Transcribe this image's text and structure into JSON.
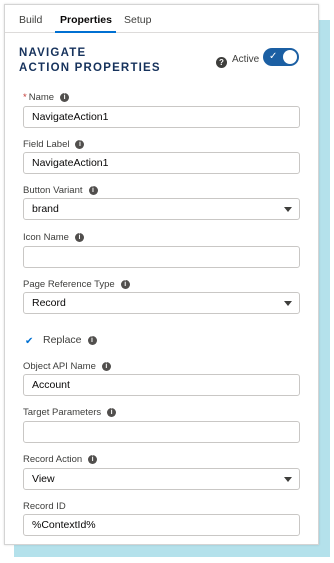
{
  "tabs": [
    {
      "label": "Build"
    },
    {
      "label": "Properties"
    },
    {
      "label": "Setup"
    }
  ],
  "header": {
    "title": "NAVIGATE\nACTION PROPERTIES",
    "active_label": "Active",
    "toggle_check": "✓"
  },
  "fields": {
    "name": {
      "label": "Name",
      "value": "NavigateAction1",
      "required_mark": "*"
    },
    "field_label": {
      "label": "Field Label",
      "value": "NavigateAction1"
    },
    "button_variant": {
      "label": "Button Variant",
      "value": "brand"
    },
    "icon_name": {
      "label": "Icon Name",
      "value": ""
    },
    "page_reference_type": {
      "label": "Page Reference Type",
      "value": "Record"
    },
    "replace": {
      "label": "Replace",
      "check": "✔"
    },
    "object_api_name": {
      "label": "Object API Name",
      "value": "Account"
    },
    "target_parameters": {
      "label": "Target Parameters",
      "value": ""
    },
    "record_action": {
      "label": "Record Action",
      "value": "View"
    },
    "record_id": {
      "label": "Record ID",
      "value": "%ContextId%"
    }
  },
  "icons": {
    "help": "?",
    "info": "i"
  },
  "colors": {
    "brand": "#1b5fa3",
    "tab_accent": "#0070d2",
    "shadow": "#b4e1eb",
    "title": "#16325c"
  }
}
